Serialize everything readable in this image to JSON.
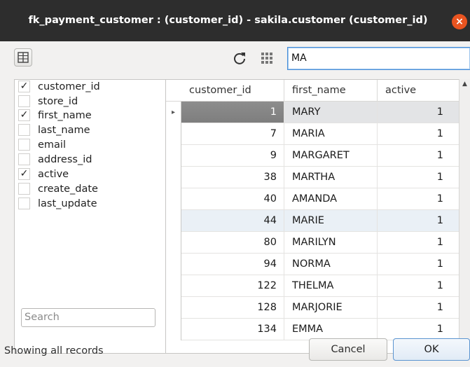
{
  "window": {
    "title": "fk_payment_customer : (customer_id) - sakila.customer (customer_id)",
    "close_glyph": "×"
  },
  "toolbar": {
    "columns_toggle_icon": "columns-icon",
    "refresh_icon": "refresh-icon",
    "grid_icon": "grid-icon",
    "filter_value": "MA"
  },
  "columns": [
    {
      "label": "customer_id",
      "checked": "✓"
    },
    {
      "label": "store_id",
      "checked": ""
    },
    {
      "label": "first_name",
      "checked": "✓"
    },
    {
      "label": "last_name",
      "checked": ""
    },
    {
      "label": "email",
      "checked": ""
    },
    {
      "label": "address_id",
      "checked": ""
    },
    {
      "label": "active",
      "checked": "✓"
    },
    {
      "label": "create_date",
      "checked": ""
    },
    {
      "label": "last_update",
      "checked": ""
    }
  ],
  "search": {
    "placeholder": "Search"
  },
  "table": {
    "headers": [
      "customer_id",
      "first_name",
      "active"
    ],
    "selected_marker": "▸",
    "rows": [
      {
        "customer_id": "1",
        "first_name": "MARY",
        "active": "1"
      },
      {
        "customer_id": "7",
        "first_name": "MARIA",
        "active": "1"
      },
      {
        "customer_id": "9",
        "first_name": "MARGARET",
        "active": "1"
      },
      {
        "customer_id": "38",
        "first_name": "MARTHA",
        "active": "1"
      },
      {
        "customer_id": "40",
        "first_name": "AMANDA",
        "active": "1"
      },
      {
        "customer_id": "44",
        "first_name": "MARIE",
        "active": "1"
      },
      {
        "customer_id": "80",
        "first_name": "MARILYN",
        "active": "1"
      },
      {
        "customer_id": "94",
        "first_name": "NORMA",
        "active": "1"
      },
      {
        "customer_id": "122",
        "first_name": "THELMA",
        "active": "1"
      },
      {
        "customer_id": "128",
        "first_name": "MARJORIE",
        "active": "1"
      },
      {
        "customer_id": "134",
        "first_name": "EMMA",
        "active": "1"
      }
    ]
  },
  "footer": {
    "status": "Showing all records",
    "cancel_label": "Cancel",
    "ok_label": "OK"
  },
  "colors": {
    "titlebar": "#2d2d2d",
    "close_button": "#e95420",
    "focus_border": "#4a90d9",
    "selected_cell": "#7e7e7e"
  }
}
